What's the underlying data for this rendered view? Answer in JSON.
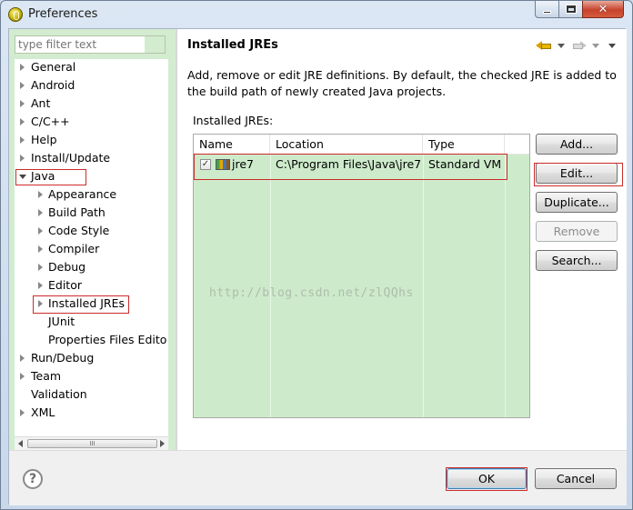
{
  "window": {
    "title": "Preferences"
  },
  "sidebar": {
    "filter_placeholder": "type filter text",
    "items": [
      {
        "label": "General",
        "expandable": true
      },
      {
        "label": "Android",
        "expandable": true
      },
      {
        "label": "Ant",
        "expandable": true
      },
      {
        "label": "C/C++",
        "expandable": true
      },
      {
        "label": "Help",
        "expandable": true
      },
      {
        "label": "Install/Update",
        "expandable": true
      },
      {
        "label": "Java",
        "expandable": true,
        "expanded": true
      },
      {
        "label": "Appearance",
        "expandable": true
      },
      {
        "label": "Build Path",
        "expandable": true
      },
      {
        "label": "Code Style",
        "expandable": true
      },
      {
        "label": "Compiler",
        "expandable": true
      },
      {
        "label": "Debug",
        "expandable": true
      },
      {
        "label": "Editor",
        "expandable": true
      },
      {
        "label": "Installed JREs",
        "expandable": true,
        "selected": true
      },
      {
        "label": "JUnit",
        "expandable": false
      },
      {
        "label": "Properties Files Edito",
        "expandable": false
      },
      {
        "label": "Run/Debug",
        "expandable": true
      },
      {
        "label": "Team",
        "expandable": true
      },
      {
        "label": "Validation",
        "expandable": false
      },
      {
        "label": "XML",
        "expandable": true
      }
    ],
    "scroll_thumb": "III"
  },
  "page": {
    "title": "Installed JREs",
    "description": "Add, remove or edit JRE definitions. By default, the checked JRE is added to the build path of newly created Java projects.",
    "table_label": "Installed JREs:",
    "columns": [
      "Name",
      "Location",
      "Type"
    ],
    "rows": [
      {
        "checked": true,
        "check_mark": "✓",
        "name": "jre7",
        "location": "C:\\Program Files\\Java\\jre7",
        "type": "Standard VM"
      }
    ],
    "watermark": "http://blog.csdn.net/zlQQhs"
  },
  "buttons": {
    "add": "Add...",
    "edit": "Edit...",
    "duplicate": "Duplicate...",
    "remove": "Remove",
    "search": "Search..."
  },
  "footer": {
    "help": "?",
    "ok": "OK",
    "cancel": "Cancel"
  },
  "colors": {
    "tree_bg": "#d3ecd0",
    "table_bg": "#cdebcb",
    "highlight": "#cc2b2b",
    "close_button": "#c7432c"
  }
}
